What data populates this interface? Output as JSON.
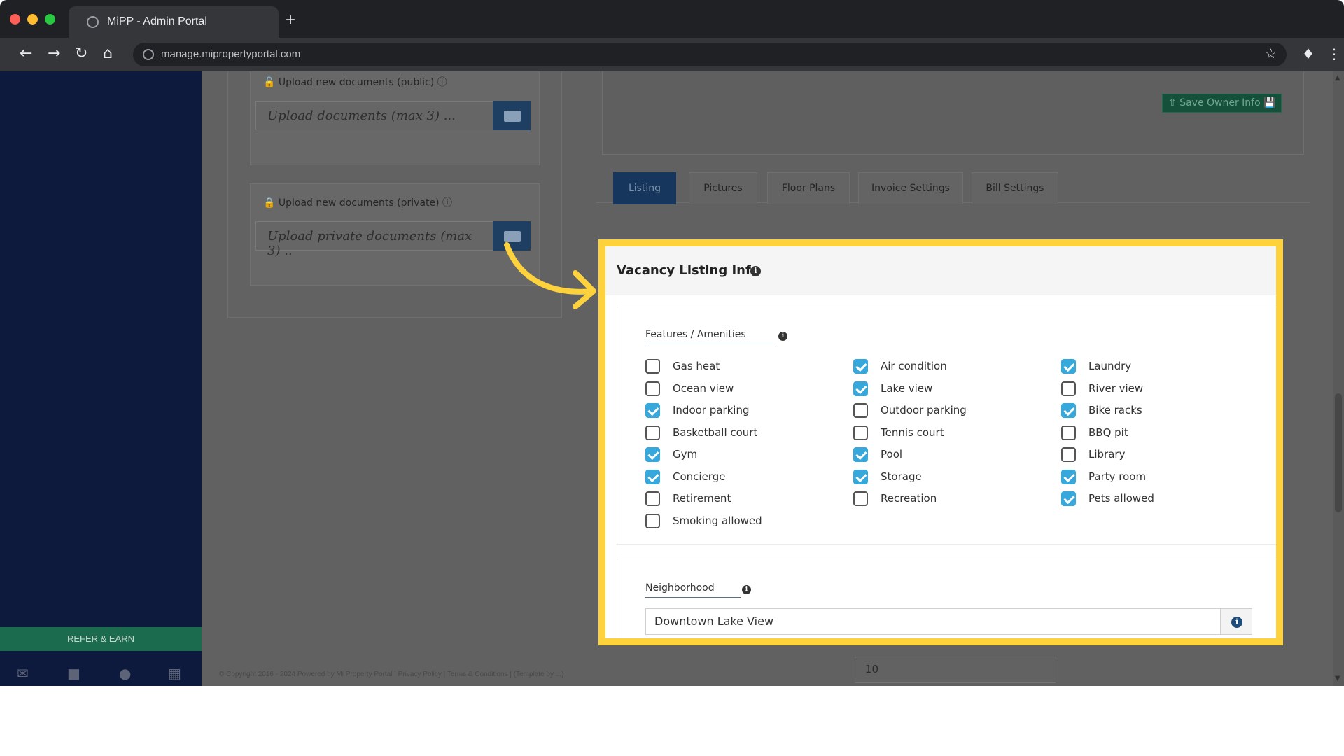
{
  "browser": {
    "tab_title": "MiPP - Admin Portal",
    "new_tab": "+",
    "url": "manage.mipropertyportal.com"
  },
  "sidebar": {
    "refer_label": "REFER & EARN"
  },
  "uploads": {
    "public_header": "Upload new documents (public)",
    "public_placeholder": "Upload documents (max 3) ...",
    "private_header": "Upload new documents (private)",
    "private_placeholder": "Upload private documents (max 3) .."
  },
  "owner": {
    "save_label": "Save Owner Info"
  },
  "tabs": [
    {
      "label": "Listing",
      "active": true
    },
    {
      "label": "Pictures",
      "active": false
    },
    {
      "label": "Floor Plans",
      "active": false
    },
    {
      "label": "Invoice Settings",
      "active": false
    },
    {
      "label": "Bill Settings",
      "active": false
    }
  ],
  "vacancy": {
    "title": "Vacancy Listing Info",
    "features_label": "Features / Amenities",
    "amenities": [
      {
        "label": "Gas heat",
        "checked": false
      },
      {
        "label": "Ocean view",
        "checked": false
      },
      {
        "label": "Indoor parking",
        "checked": true
      },
      {
        "label": "Basketball court",
        "checked": false
      },
      {
        "label": "Gym",
        "checked": true
      },
      {
        "label": "Concierge",
        "checked": true
      },
      {
        "label": "Retirement",
        "checked": false
      },
      {
        "label": "Smoking allowed",
        "checked": false
      },
      {
        "label": "Air condition",
        "checked": true
      },
      {
        "label": "Lake view",
        "checked": true
      },
      {
        "label": "Outdoor parking",
        "checked": false
      },
      {
        "label": "Tennis court",
        "checked": false
      },
      {
        "label": "Pool",
        "checked": true
      },
      {
        "label": "Storage",
        "checked": true
      },
      {
        "label": "Recreation",
        "checked": false
      },
      {
        "label": "Laundry",
        "checked": true
      },
      {
        "label": "River view",
        "checked": false
      },
      {
        "label": "Bike racks",
        "checked": true
      },
      {
        "label": "BBQ pit",
        "checked": false
      },
      {
        "label": "Library",
        "checked": false
      },
      {
        "label": "Party room",
        "checked": true
      },
      {
        "label": "Pets allowed",
        "checked": true
      }
    ],
    "neighborhood_label": "Neighborhood",
    "neighborhood_value": "Downtown Lake View"
  },
  "below": {
    "field_value": "10"
  },
  "footer": {
    "text": "© Copyright 2016 - 2024 Powered by Mi Property Portal | Privacy Policy | Terms & Conditions | (Template by ...)"
  },
  "colors": {
    "highlight": "#fdd23c",
    "checkbox_checked": "#37a8db",
    "active_tab": "#16365d",
    "sidebar": "#0d1a3e"
  }
}
